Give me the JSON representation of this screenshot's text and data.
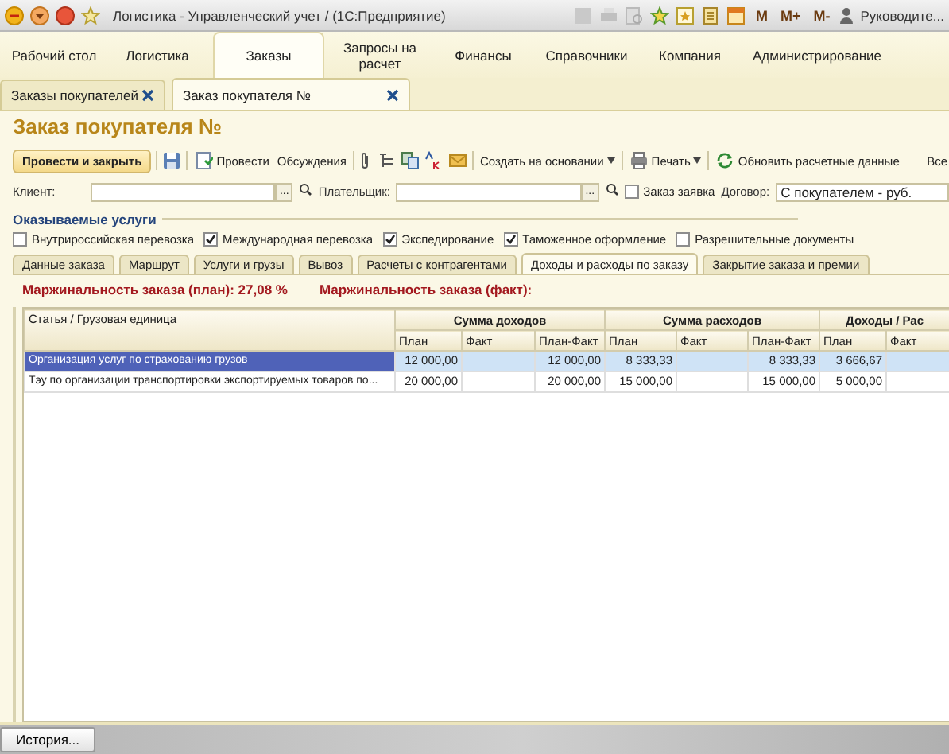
{
  "window": {
    "title": "Логистика - Управленческий учет /   (1С:Предприятие)",
    "memory_buttons": [
      "M",
      "M+",
      "M-"
    ],
    "user": "Руководите..."
  },
  "sections": [
    {
      "label": "Рабочий стол",
      "selected": false
    },
    {
      "label": "Логистика",
      "selected": false
    },
    {
      "label": "Заказы",
      "selected": true
    },
    {
      "label": "Запросы на расчет",
      "selected": false
    },
    {
      "label": "Финансы",
      "selected": false
    },
    {
      "label": "Справочники",
      "selected": false
    },
    {
      "label": "Компания",
      "selected": false
    },
    {
      "label": "Администрирование",
      "selected": false
    }
  ],
  "open_tabs": [
    {
      "label": "Заказы покупателей",
      "selected": false
    },
    {
      "label": "Заказ покупателя №",
      "selected": true
    }
  ],
  "form": {
    "title": "Заказ покупателя №",
    "toolbar": [
      {
        "kind": "primary",
        "label": "Провести и закрыть"
      },
      {
        "kind": "save"
      },
      {
        "kind": "post",
        "label": "Провести"
      },
      {
        "kind": "text",
        "label": "Обсуждения"
      },
      {
        "kind": "attach"
      },
      {
        "kind": "structure"
      },
      {
        "kind": "related"
      },
      {
        "kind": "dtkt"
      },
      {
        "kind": "mail"
      },
      {
        "kind": "dropdown",
        "label": "Создать на основании"
      },
      {
        "kind": "print",
        "label": "Печать"
      },
      {
        "kind": "refresh",
        "label": "Обновить расчетные данные"
      },
      {
        "kind": "text",
        "label": "Все"
      }
    ],
    "client": {
      "label": "Клиент:",
      "picker": "..."
    },
    "payer": {
      "label": "Плательщик:",
      "picker": "..."
    },
    "request_order": {
      "label": "Заказ заявка",
      "checked": false
    },
    "contract": {
      "label": "Договор:",
      "value": "С покупателем - руб."
    },
    "services_title": "Оказываемые услуги",
    "services": [
      {
        "label": "Внутрироссийская перевозка",
        "checked": false
      },
      {
        "label": "Международная перевозка",
        "checked": true
      },
      {
        "label": "Экспедирование",
        "checked": true
      },
      {
        "label": "Таможенное оформление",
        "checked": true
      },
      {
        "label": "Разрешительные документы",
        "checked": false
      }
    ],
    "tabs": [
      {
        "label": "Данные заказа",
        "selected": false
      },
      {
        "label": "Маршрут",
        "selected": false
      },
      {
        "label": "Услуги и грузы",
        "selected": false
      },
      {
        "label": "Вывоз",
        "selected": false
      },
      {
        "label": "Расчеты с контрагентами",
        "selected": false
      },
      {
        "label": "Доходы и расходы по заказу",
        "selected": true
      },
      {
        "label": "Закрытие заказа и премии",
        "selected": false
      }
    ],
    "margins": [
      "Маржинальность заказа (план): 27,08 %",
      "Маржинальность заказа (факт):"
    ],
    "table": {
      "first_column": "Статья / Грузовая единица",
      "groups": [
        {
          "title": "Сумма доходов",
          "columns": [
            "План",
            "Факт",
            "План-Факт"
          ]
        },
        {
          "title": "Сумма расходов",
          "columns": [
            "План",
            "Факт",
            "План-Факт"
          ]
        },
        {
          "title": "Доходы / Рас",
          "columns": [
            "План",
            "Факт"
          ]
        }
      ],
      "rows": [
        {
          "item": "Организация услуг по страхованию грузов",
          "selected": true,
          "income": {
            "plan": "12 000,00",
            "plan_fact": "12 000,00"
          },
          "expense": {
            "plan": "8 333,33",
            "plan_fact": "8 333,33"
          },
          "net": {
            "plan": "3 666,67"
          }
        },
        {
          "item": "Тэу по организации транспортировки экспортируемых товаров по...",
          "selected": false,
          "income": {
            "plan": "20 000,00",
            "plan_fact": "20 000,00"
          },
          "expense": {
            "plan": "15 000,00",
            "plan_fact": "15 000,00"
          },
          "net": {
            "plan": "5 000,00"
          }
        }
      ]
    }
  },
  "footer": {
    "history_button": "История..."
  }
}
